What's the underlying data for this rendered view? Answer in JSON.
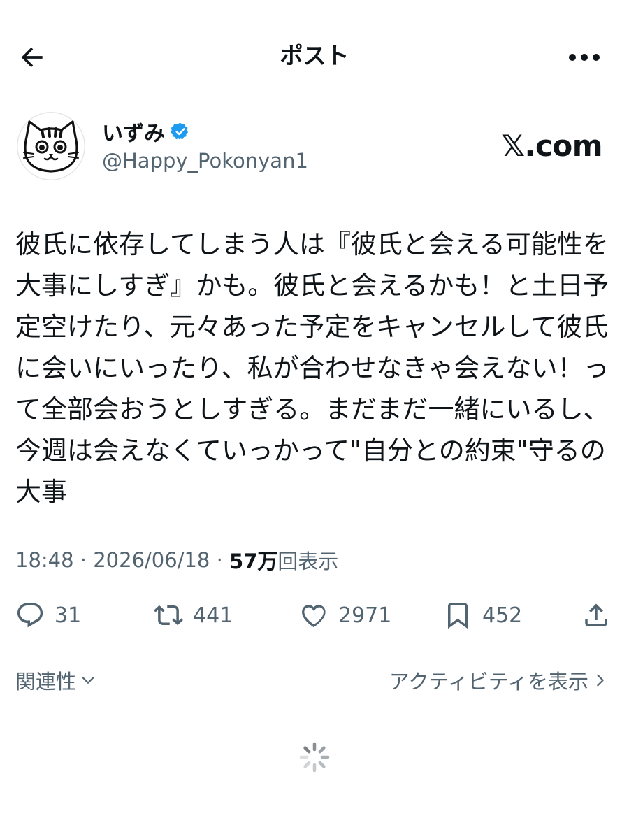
{
  "header": {
    "title": "ポスト"
  },
  "author": {
    "name": "いずみ",
    "handle": "@Happy_Pokonyan1",
    "verified": true,
    "avatar_icon": "cat-avatar"
  },
  "watermark": "𝕏.com",
  "tweet": {
    "lines": [
      "彼氏に依存してしまう人は『彼氏と会える可能性を",
      "大事にしすぎ』かも。彼氏と会えるかも！と土日予",
      "定空けたり、元々あった予定をキャンセルして彼氏",
      "に会いにいったり、私が合わせなきゃ会えない！っ",
      "て全部会おうとしすぎる。まだまだ一緒にいるし、",
      "今週は会えなくていっかって\"自分との約束\"守るの",
      "大事"
    ]
  },
  "meta": {
    "time": "18:48",
    "sep1": " · ",
    "date": "2026/06/18",
    "sep2": " · ",
    "views_count": "57万",
    "views_label": "回表示"
  },
  "actions": {
    "replies": "31",
    "reposts": "441",
    "likes": "2971",
    "bookmarks": "452"
  },
  "footer": {
    "relevance_label": "関連性",
    "activity_label": "アクティビティを表示"
  },
  "colors": {
    "text": "#0f1419",
    "secondary": "#536471",
    "verified": "#1d9bf0"
  }
}
